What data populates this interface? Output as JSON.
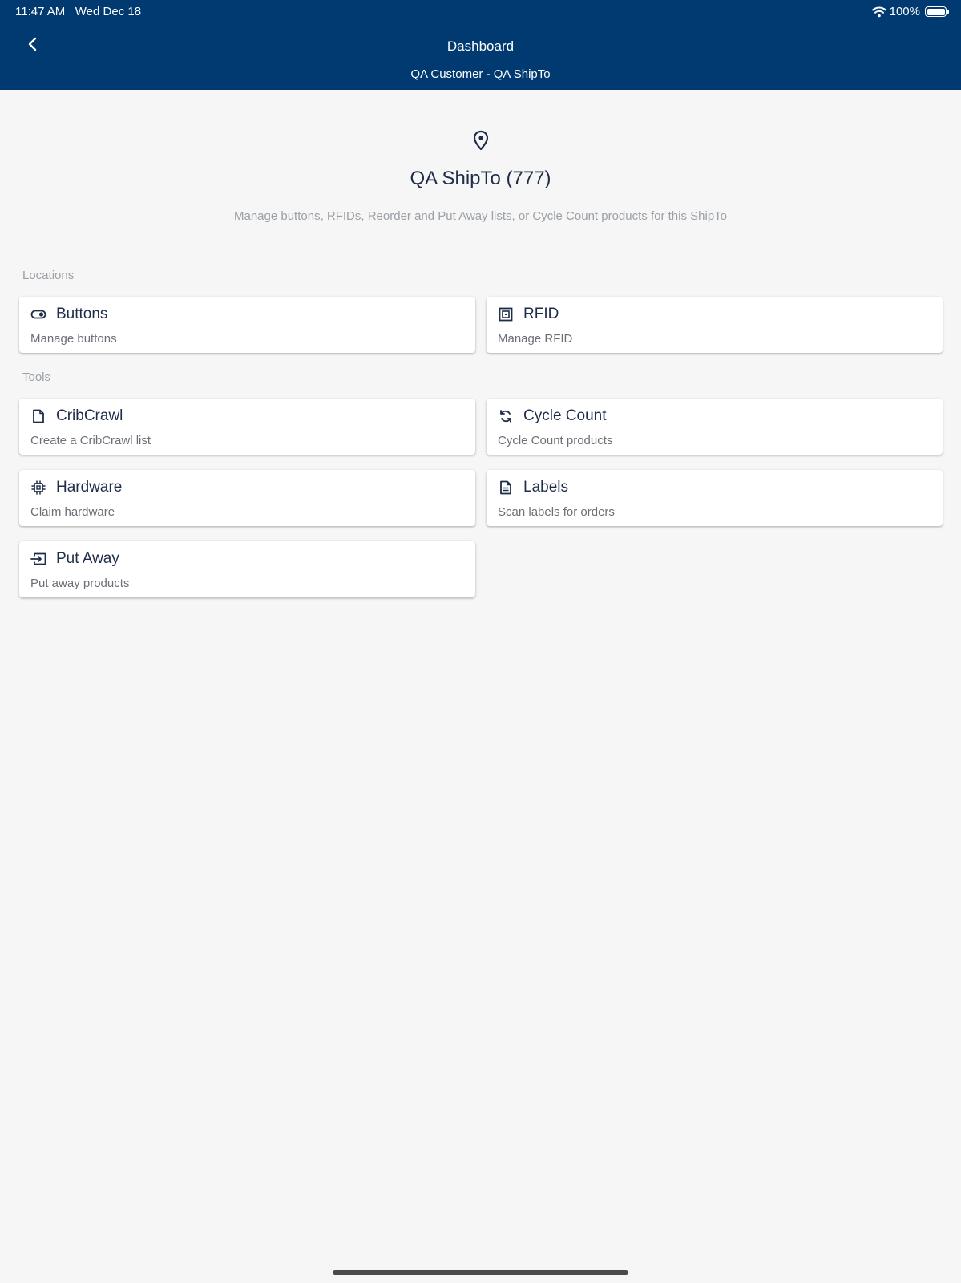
{
  "status_bar": {
    "time": "11:47 AM",
    "date": "Wed Dec 18",
    "battery": "100%"
  },
  "header": {
    "title": "Dashboard",
    "subtitle": "QA Customer - QA ShipTo"
  },
  "hero": {
    "icon": "map-pin-icon",
    "title": "QA ShipTo (777)",
    "description": "Manage buttons, RFIDs, Reorder and Put Away lists, or Cycle Count products for this ShipTo"
  },
  "sections": {
    "locations": {
      "label": "Locations",
      "cards": [
        {
          "icon": "toggle-icon",
          "title": "Buttons",
          "description": "Manage buttons"
        },
        {
          "icon": "rfid-icon",
          "title": "RFID",
          "description": "Manage RFID"
        }
      ]
    },
    "tools": {
      "label": "Tools",
      "cards": [
        {
          "icon": "file-icon",
          "title": "CribCrawl",
          "description": "Create a CribCrawl list"
        },
        {
          "icon": "refresh-icon",
          "title": "Cycle Count",
          "description": "Cycle Count products"
        },
        {
          "icon": "chip-icon",
          "title": "Hardware",
          "description": "Claim hardware"
        },
        {
          "icon": "document-icon",
          "title": "Labels",
          "description": "Scan labels for orders"
        },
        {
          "icon": "put-away-icon",
          "title": "Put Away",
          "description": "Put away products"
        }
      ]
    }
  },
  "colors": {
    "header_bg": "#003a70",
    "page_bg": "#f6f6f6",
    "text_dark": "#1f2d4a",
    "text_muted": "#9aa0a6"
  }
}
